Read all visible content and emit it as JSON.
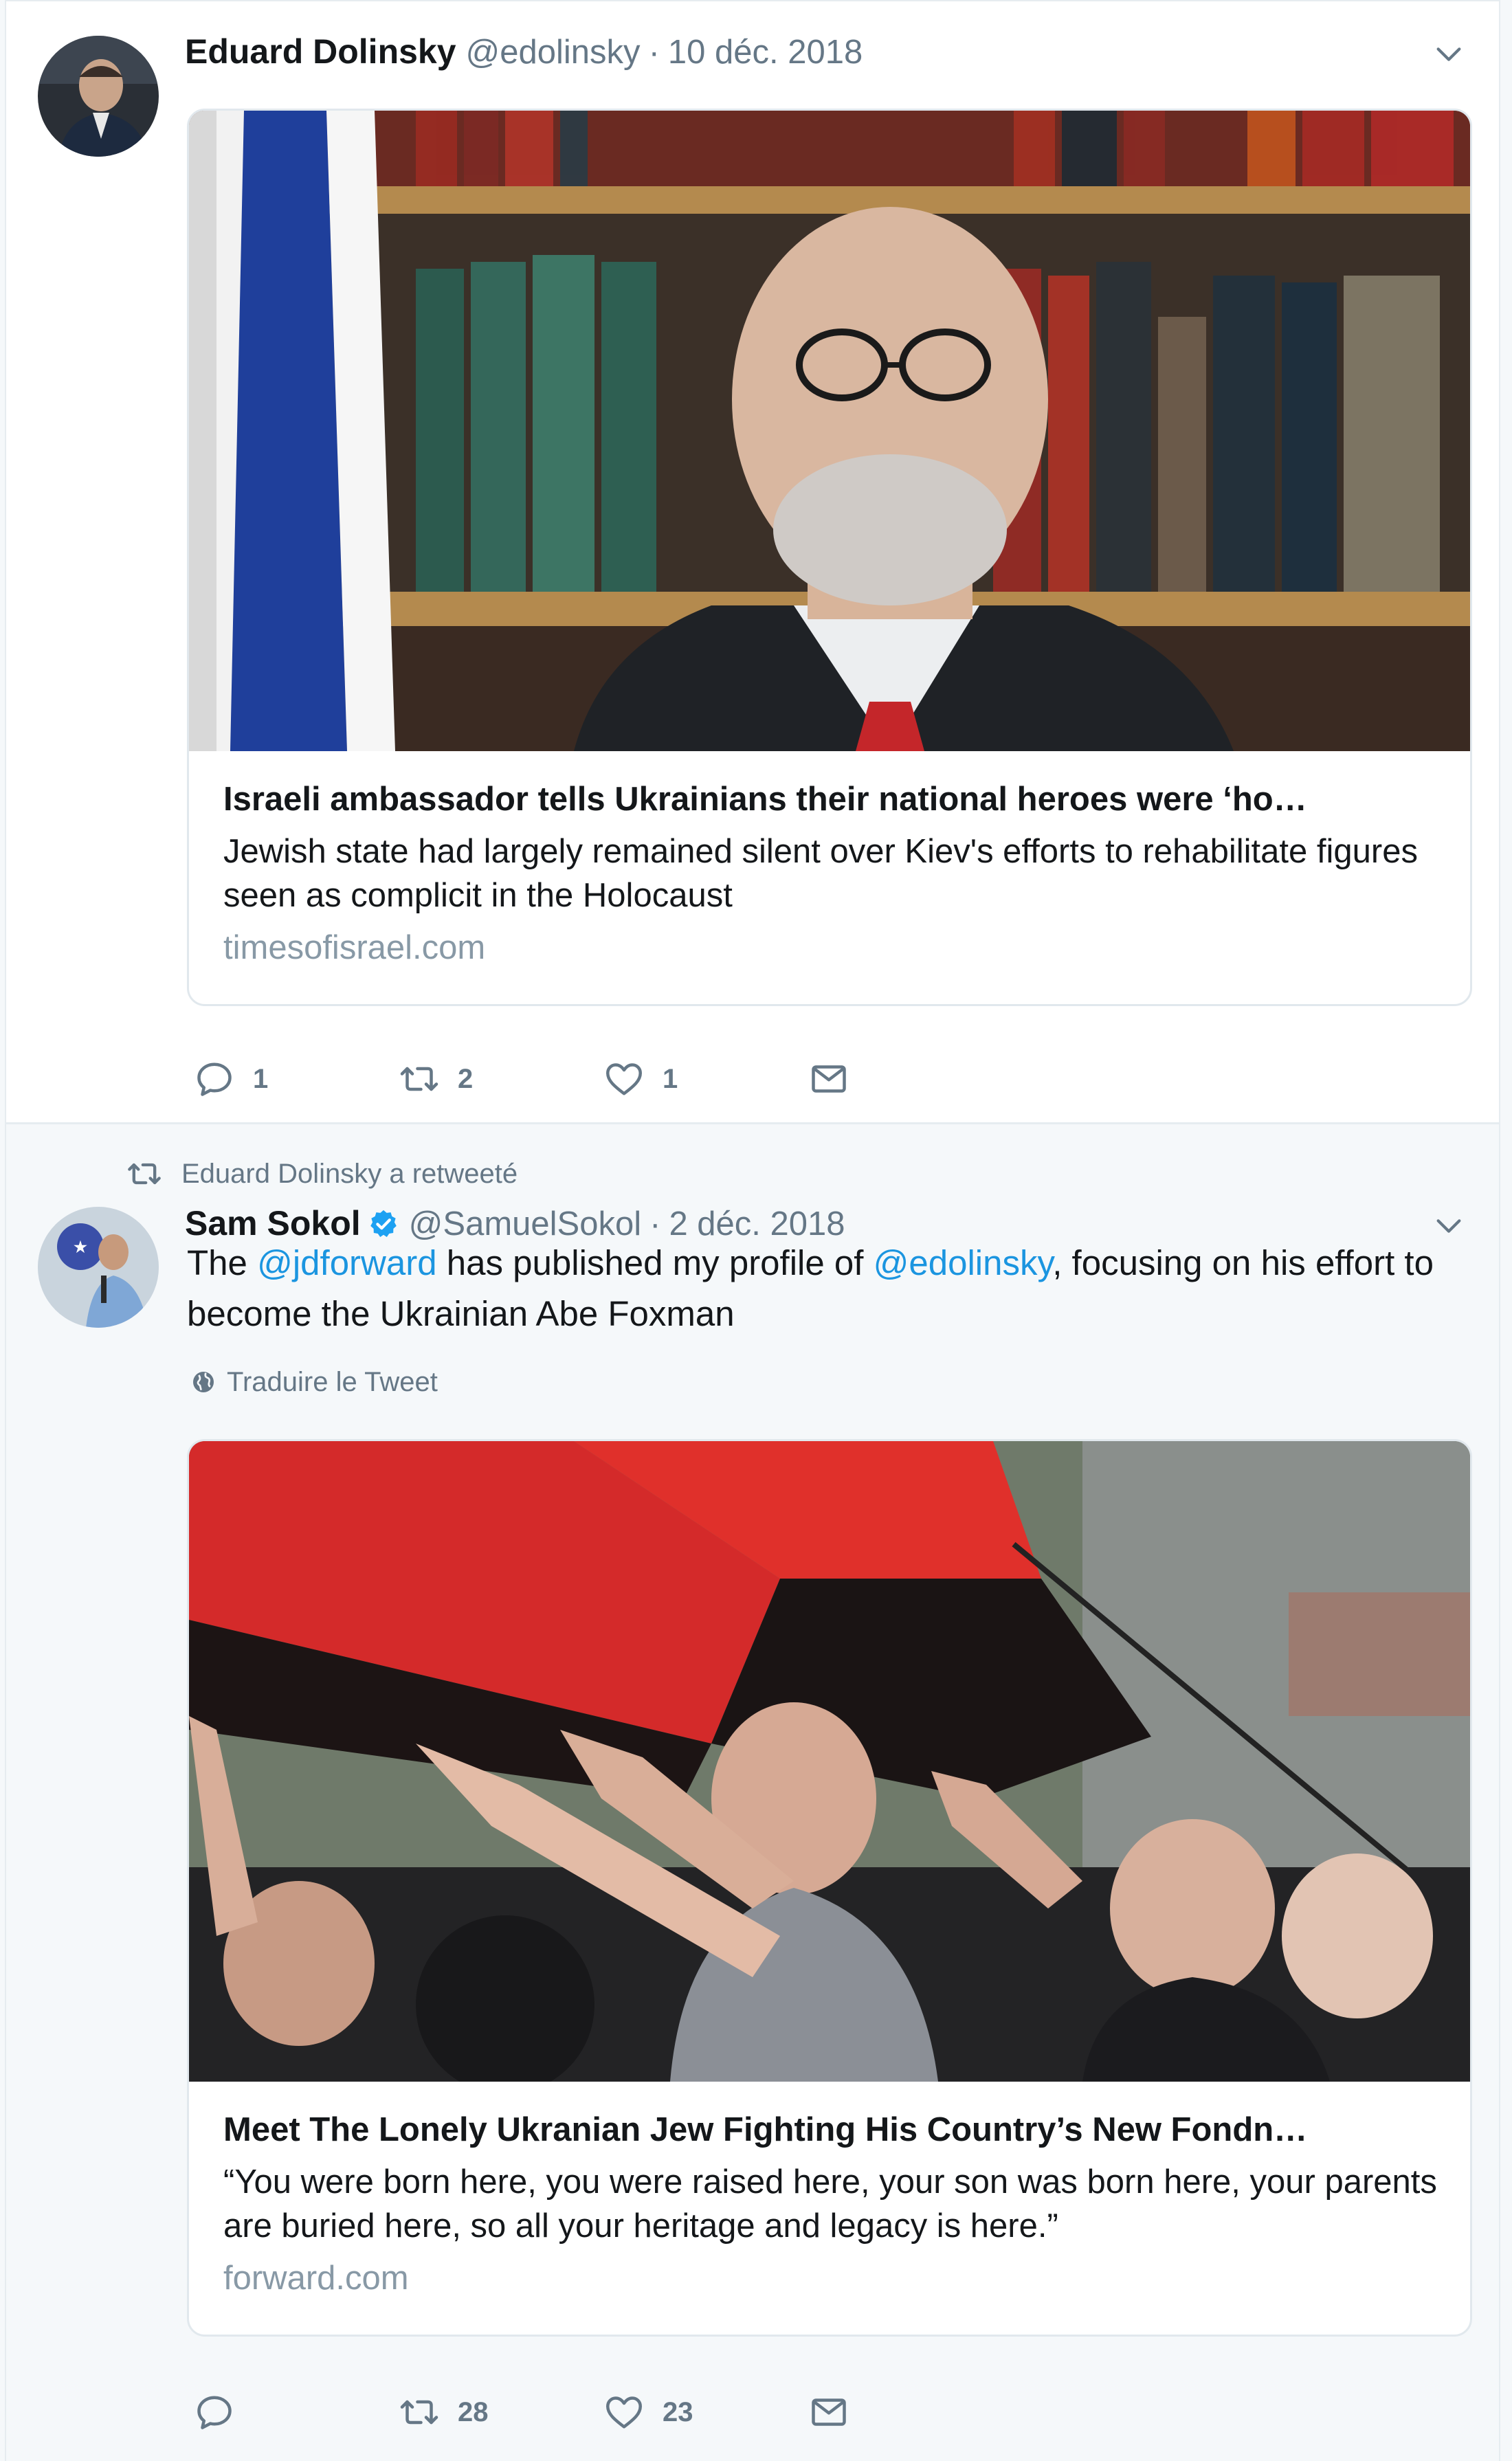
{
  "tweets": [
    {
      "author_name": "Eduard Dolinsky",
      "author_handle": "@edolinsky",
      "separator": "·",
      "date": "10 déc. 2018",
      "card": {
        "title": "Israeli ambassador tells Ukrainians their national heroes were ‘ho…",
        "description": "Jewish state had largely remained silent over Kiev's efforts to rehabilitate figures seen as complicit in the Holocaust",
        "domain": "timesofisrael.com"
      },
      "actions": {
        "reply_count": "1",
        "retweet_count": "2",
        "like_count": "1"
      }
    },
    {
      "retweet_context": "Eduard Dolinsky a retweeté",
      "author_name": "Sam Sokol",
      "author_handle": "@SamuelSokol",
      "separator": "·",
      "date": "2 déc. 2018",
      "text": {
        "part1": "The ",
        "mention1": "@jdforward",
        "part2": " has published my profile of ",
        "mention2": "@edolinsky",
        "part3": ", focusing on his effort to become the Ukrainian Abe Foxman"
      },
      "translate_label": "Traduire le Tweet",
      "card": {
        "title": "Meet The Lonely Ukranian Jew Fighting His Country’s New Fondn…",
        "description": "“You were born here, you were raised here, your son was born here, your parents are buried here, so all your heritage and legacy is here.”",
        "domain": "forward.com"
      },
      "actions": {
        "reply_count": "",
        "retweet_count": "28",
        "like_count": "23"
      }
    }
  ],
  "icons": [
    "reply-icon",
    "retweet-icon",
    "like-icon",
    "direct-message-icon",
    "caret-down-icon",
    "verified-icon",
    "globe-icon"
  ],
  "colors": {
    "link": "#1b95e0",
    "secondary": "#657786",
    "verified": "#1da1f2"
  }
}
